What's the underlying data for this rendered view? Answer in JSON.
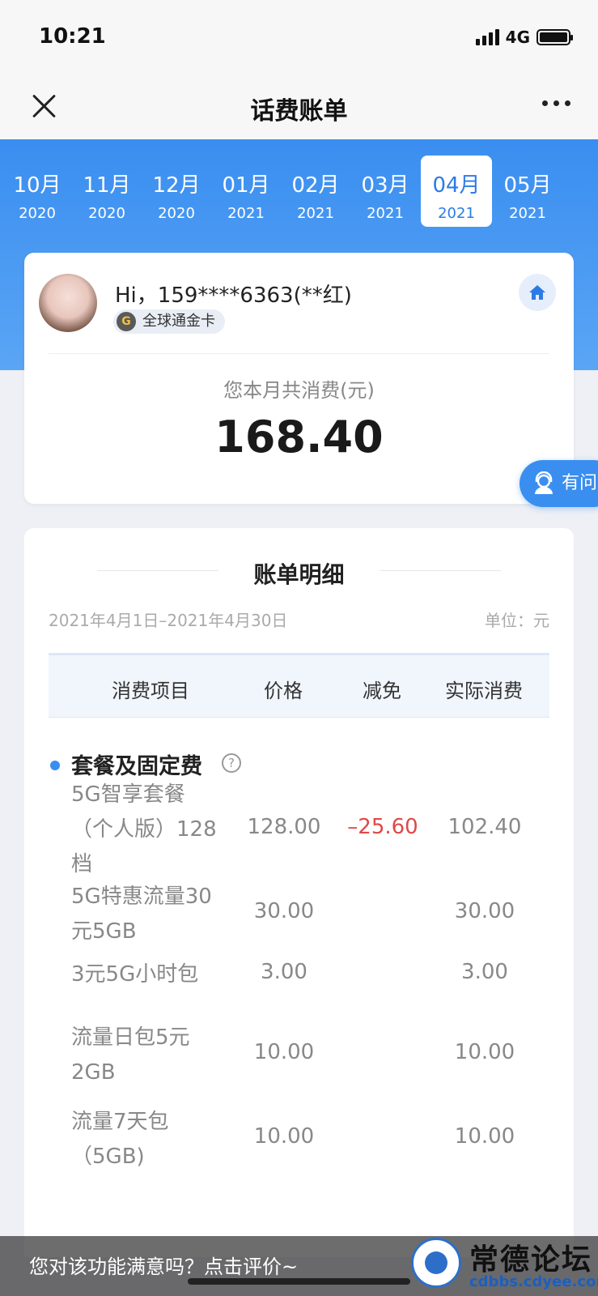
{
  "status_bar": {
    "time": "10:21",
    "network": "4G"
  },
  "nav": {
    "title": "话费账单"
  },
  "months": [
    {
      "month": "10月",
      "year": "2020",
      "active": false
    },
    {
      "month": "11月",
      "year": "2020",
      "active": false
    },
    {
      "month": "12月",
      "year": "2020",
      "active": false
    },
    {
      "month": "01月",
      "year": "2021",
      "active": false
    },
    {
      "month": "02月",
      "year": "2021",
      "active": false
    },
    {
      "month": "03月",
      "year": "2021",
      "active": false
    },
    {
      "month": "04月",
      "year": "2021",
      "active": true
    },
    {
      "month": "05月",
      "year": "2021",
      "active": false
    }
  ],
  "summary": {
    "greeting": "Hi，159****6363(**红)",
    "badge": "全球通金卡",
    "badge_icon": "G",
    "total_label": "您本月共消费(元)",
    "total_value": "168.40"
  },
  "help": {
    "label": "有问"
  },
  "detail": {
    "title": "账单明细",
    "period": "2021年4月1日–2021年4月30日",
    "unit": "单位：元",
    "columns": [
      "消费项目",
      "价格",
      "减免",
      "实际消费"
    ],
    "section_title": "套餐及固定费",
    "rows": [
      {
        "name_lines": [
          "5G智享套餐",
          "（个人版）128",
          "档"
        ],
        "price": "128.00",
        "discount": "–25.60",
        "actual": "102.40"
      },
      {
        "name_lines": [
          "5G特惠流量30",
          "元5GB"
        ],
        "price": "30.00",
        "discount": "",
        "actual": "30.00"
      },
      {
        "name_lines": [
          "3元5G小时包"
        ],
        "price": "3.00",
        "discount": "",
        "actual": "3.00"
      },
      {
        "name_lines": [
          "流量日包5元",
          "2GB"
        ],
        "price": "10.00",
        "discount": "",
        "actual": "10.00"
      },
      {
        "name_lines": [
          "流量7天包",
          "（5GB)"
        ],
        "price": "10.00",
        "discount": "",
        "actual": "10.00"
      }
    ]
  },
  "feedback": {
    "text": "您对该功能满意吗？点击评价~"
  },
  "watermark": {
    "title": "常德论坛",
    "url": "cdbbs.cdyee.com"
  },
  "colors": {
    "accent": "#3a8ef0",
    "discount": "#e04848"
  }
}
